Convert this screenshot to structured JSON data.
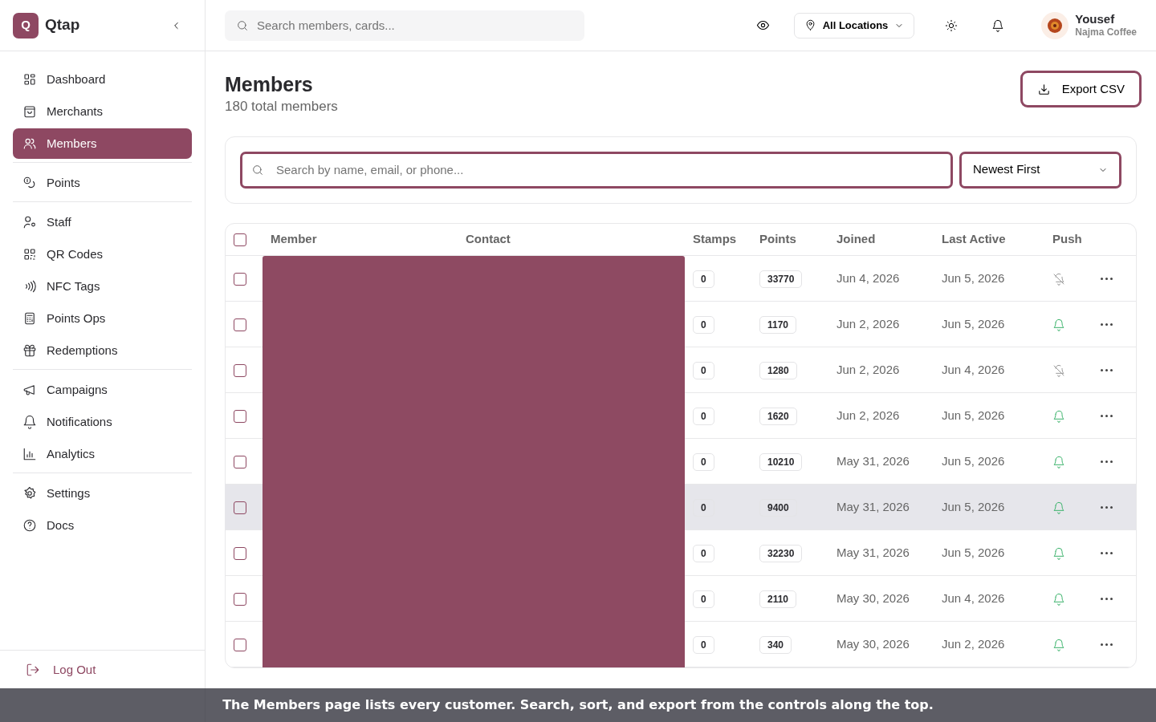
{
  "brand": {
    "initial": "Q",
    "name": "Qtap"
  },
  "sidebar": {
    "groups": [
      {
        "items": [
          {
            "label": "Dashboard",
            "selected": false
          },
          {
            "label": "Merchants",
            "selected": false
          },
          {
            "label": "Members",
            "selected": true
          }
        ]
      },
      {
        "items": [
          {
            "label": "Points",
            "selected": false
          }
        ]
      },
      {
        "items": [
          {
            "label": "Staff",
            "selected": false
          },
          {
            "label": "QR Codes",
            "selected": false
          },
          {
            "label": "NFC Tags",
            "selected": false
          },
          {
            "label": "Points Ops",
            "selected": false
          },
          {
            "label": "Redemptions",
            "selected": false
          }
        ]
      },
      {
        "items": [
          {
            "label": "Campaigns",
            "selected": false
          },
          {
            "label": "Notifications",
            "selected": false
          },
          {
            "label": "Analytics",
            "selected": false
          }
        ]
      },
      {
        "items": [
          {
            "label": "Settings",
            "selected": false
          },
          {
            "label": "Docs",
            "selected": false
          }
        ]
      }
    ],
    "logout": "Log Out"
  },
  "topbar": {
    "search": {
      "placeholder": "Search members, cards..."
    },
    "location": "All Locations",
    "user": {
      "name": "Yousef",
      "business": "Najma Coffee"
    }
  },
  "page": {
    "title": "Members",
    "subtitle": "180 total members",
    "export": "Export CSV"
  },
  "filters": {
    "search": {
      "placeholder": "Search by name, email, or phone..."
    },
    "sort": "Newest First"
  },
  "table": {
    "select_all": false,
    "columns": [
      "Member",
      "Contact",
      "Stamps",
      "Points",
      "Joined",
      "Last Active",
      "Push"
    ],
    "rows": [
      {
        "selected": false,
        "hovered": false,
        "stamps": "0",
        "points": "33770",
        "joined": "Jun 4, 2026",
        "last_active": "Jun 5, 2026",
        "push": false
      },
      {
        "selected": false,
        "hovered": false,
        "stamps": "0",
        "points": "1170",
        "joined": "Jun 2, 2026",
        "last_active": "Jun 5, 2026",
        "push": true
      },
      {
        "selected": false,
        "hovered": false,
        "stamps": "0",
        "points": "1280",
        "joined": "Jun 2, 2026",
        "last_active": "Jun 4, 2026",
        "push": false
      },
      {
        "selected": false,
        "hovered": false,
        "stamps": "0",
        "points": "1620",
        "joined": "Jun 2, 2026",
        "last_active": "Jun 5, 2026",
        "push": true
      },
      {
        "selected": false,
        "hovered": false,
        "stamps": "0",
        "points": "10210",
        "joined": "May 31, 2026",
        "last_active": "Jun 5, 2026",
        "push": true
      },
      {
        "selected": false,
        "hovered": true,
        "stamps": "0",
        "points": "9400",
        "joined": "May 31, 2026",
        "last_active": "Jun 5, 2026",
        "push": true
      },
      {
        "selected": false,
        "hovered": false,
        "stamps": "0",
        "points": "32230",
        "joined": "May 31, 2026",
        "last_active": "Jun 5, 2026",
        "push": true
      },
      {
        "selected": false,
        "hovered": false,
        "stamps": "0",
        "points": "2110",
        "joined": "May 30, 2026",
        "last_active": "Jun 4, 2026",
        "push": true
      },
      {
        "selected": false,
        "hovered": false,
        "stamps": "0",
        "points": "340",
        "joined": "May 30, 2026",
        "last_active": "Jun 2, 2026",
        "push": true
      }
    ]
  },
  "caption": "The Members page lists every customer. Search, sort, and export from the controls along the top."
}
